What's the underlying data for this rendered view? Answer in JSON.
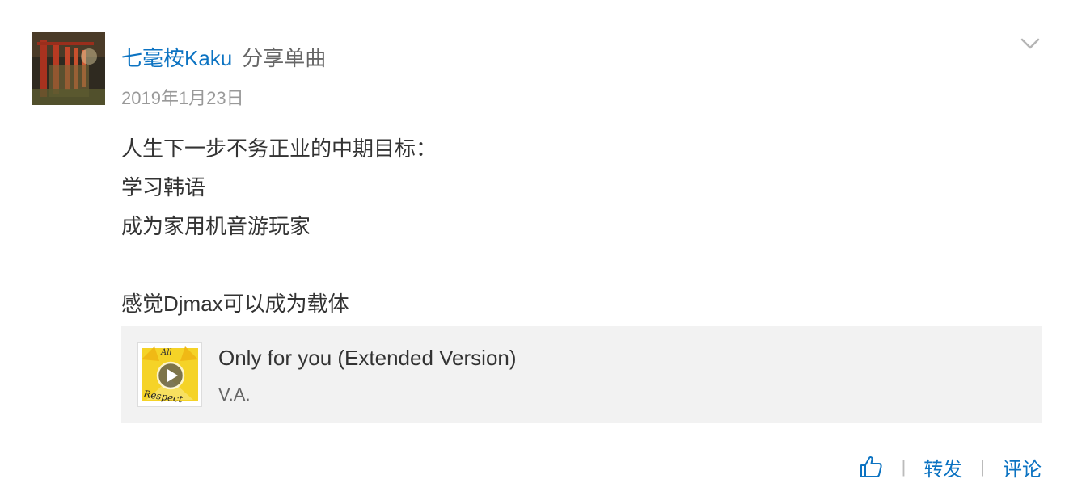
{
  "post": {
    "author": "七毫桉Kaku",
    "action": "分享单曲",
    "date": "2019年1月23日",
    "lines": [
      "人生下一步不务正业的中期目标：",
      "学习韩语",
      "成为家用机音游玩家",
      "",
      "感觉Djmax可以成为载体"
    ]
  },
  "song": {
    "title": "Only for you (Extended Version)",
    "artist": "V.A.",
    "cover_text": [
      "All",
      "Respect"
    ]
  },
  "actions": {
    "like_icon": "thumbs-up-icon",
    "repost_label": "转发",
    "comment_label": "评论",
    "separator": "|"
  },
  "menu": {
    "icon": "chevron-down-icon"
  },
  "colors": {
    "link": "#0c73c2",
    "card_bg": "#f2f2f2",
    "muted": "#999999"
  }
}
